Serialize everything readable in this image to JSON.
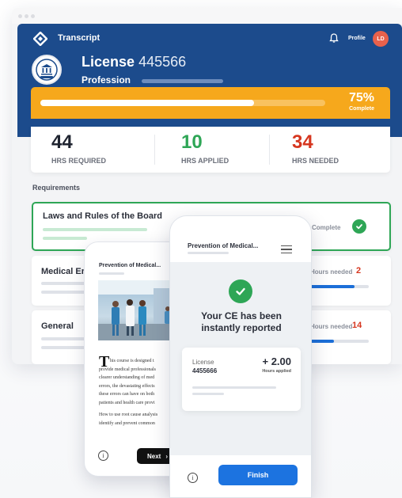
{
  "app": {
    "title": "Transcript",
    "profile_label": "Profile",
    "avatar_initials": "LD"
  },
  "license": {
    "label": "License",
    "number": "445566",
    "profession_label": "Profession"
  },
  "progress": {
    "percent_text": "75%",
    "complete_label": "Complete",
    "fraction": 0.75
  },
  "stats": [
    {
      "value": "44",
      "label": "HRS REQUIRED",
      "color": "#1f2430"
    },
    {
      "value": "10",
      "label": "HRS APPLIED",
      "color": "#2ea656"
    },
    {
      "value": "34",
      "label": "HRS NEEDED",
      "color": "#d6361f"
    }
  ],
  "requirements": {
    "heading": "Requirements",
    "items": [
      {
        "title": "Laws and Rules of the Board",
        "status": "Complete"
      },
      {
        "title": "Medical Er",
        "status": "Hours needed",
        "count": "2",
        "fraction": 0.75
      },
      {
        "title": "General",
        "status": "Hours needed",
        "count": "14",
        "fraction": 0.4
      }
    ]
  },
  "course_phone": {
    "title": "Prevention of Medical...",
    "drop_cap": "T",
    "body_lines": [
      "his course is designed t",
      "provide medical professionals",
      "clearer understanding of med",
      "errors, the devastating effects",
      "these errors can have on both",
      "patients and health care provi"
    ],
    "body_lines2": [
      "How to use root cause analysis",
      "identify and prevent common"
    ],
    "next_label": "Next",
    "next_chevron": "›"
  },
  "report_phone": {
    "title": "Prevention of Medical...",
    "message_line1": "Your CE has been",
    "message_line2": "instantly reported",
    "license_label": "License",
    "license_number": "4455666",
    "hours_value": "+ 2.00",
    "hours_label": "Hours applied",
    "finish_label": "Finish"
  },
  "colors": {
    "brand_blue": "#1c4b8c",
    "progress_orange": "#f6a81c",
    "success_green": "#2ea656",
    "alert_red": "#d6361f",
    "button_blue": "#1c73e0"
  }
}
